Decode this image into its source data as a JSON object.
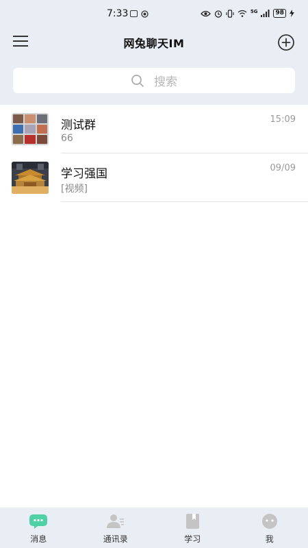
{
  "status_bar": {
    "time": "7:33",
    "battery": "98",
    "network": "5G"
  },
  "header": {
    "title": "网兔聊天IM"
  },
  "search": {
    "placeholder": "搜索"
  },
  "chats": [
    {
      "name": "测试群",
      "time": "15:09",
      "preview": "66"
    },
    {
      "name": "学习强国",
      "time": "09/09",
      "preview": "[视频]"
    }
  ],
  "tabs": [
    {
      "label": "消息",
      "active": true
    },
    {
      "label": "通讯录",
      "active": false
    },
    {
      "label": "学习",
      "active": false
    },
    {
      "label": "我",
      "active": false
    }
  ],
  "colors": {
    "accent": "#4fd1a5",
    "inactive_icon": "#c4c4c4",
    "header_bg": "#e9edf4"
  }
}
